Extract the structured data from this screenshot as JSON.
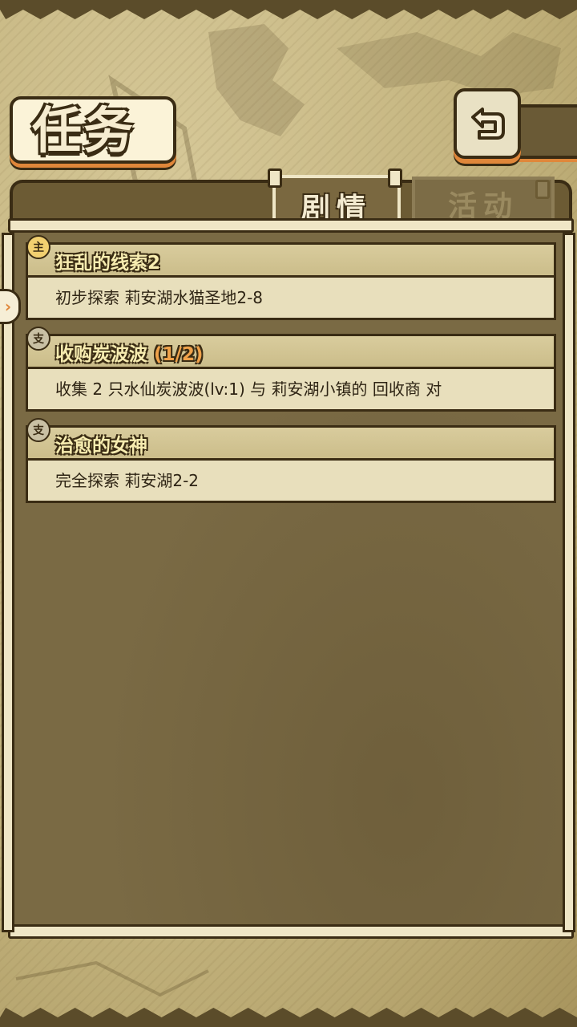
{
  "screen": {
    "title": "任务"
  },
  "header": {
    "back_icon": "back-arrow-icon"
  },
  "tabs": [
    {
      "label": "剧情",
      "active": true
    },
    {
      "label": "活动",
      "active": false
    }
  ],
  "quests": [
    {
      "badge": "主",
      "type": "main",
      "title": "狂乱的线索2",
      "progress": "",
      "description": "初步探索 莉安湖水猫圣地2-8",
      "selected": true
    },
    {
      "badge": "支",
      "type": "side",
      "title": "收购炭波波",
      "progress": "(1/2)",
      "description": "收集 2 只水仙炭波波(lv:1) 与 莉安湖小镇的 回收商 对",
      "selected": false
    },
    {
      "badge": "支",
      "type": "side",
      "title": "治愈的女神",
      "progress": "",
      "description": "完全探索 莉安湖2-2",
      "selected": false
    }
  ],
  "colors": {
    "frame_dark": "#3a2c14",
    "accent_orange": "#e0873a",
    "title_yellow": "#f7ecb0",
    "progress_orange": "#f0a24a"
  }
}
